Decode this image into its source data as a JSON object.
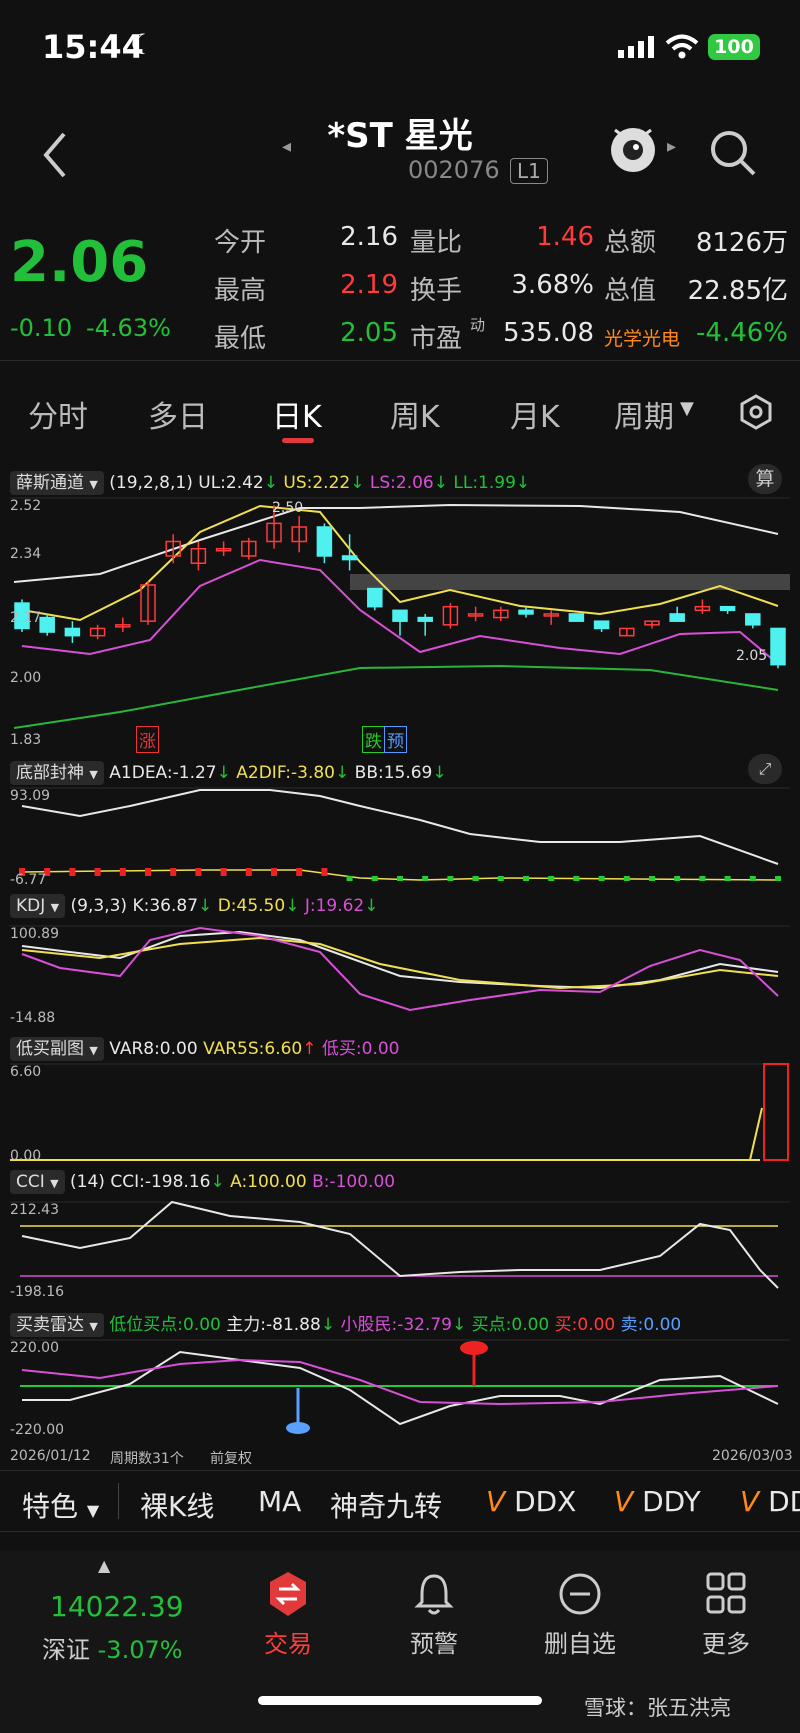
{
  "status": {
    "time": "15:44",
    "battery": "100"
  },
  "header": {
    "name": "*ST 星光",
    "code": "002076",
    "level": "L1"
  },
  "quote": {
    "price": "2.06",
    "change": "-0.10",
    "change_pct": "-4.63%",
    "rows": [
      {
        "l1": "今开",
        "v1": "2.16",
        "l2": "量比",
        "v2": "1.46",
        "l3": "总额",
        "v3": "8126万"
      },
      {
        "l1": "最高",
        "v1": "2.19",
        "l2": "换手",
        "v2": "3.68%",
        "l3": "总值",
        "v3": "22.85亿"
      },
      {
        "l1": "最低",
        "v1": "2.05",
        "l2": "市盈",
        "l2sup": "动",
        "v2": "535.08",
        "l3": "光学光电",
        "v3": "-4.46%"
      }
    ]
  },
  "tabs": [
    "分时",
    "多日",
    "日K",
    "周K",
    "月K",
    "周期"
  ],
  "panels": {
    "xs": {
      "name": "薛斯通道",
      "params": "(19,2,8,1)",
      "ul": "UL:2.42",
      "us": "US:2.22",
      "ls": "LS:2.06",
      "ll": "LL:1.99",
      "ticks": [
        "2.52",
        "2.34",
        "2.17",
        "2.00",
        "1.83"
      ],
      "hi": "2.50",
      "lo": "2.05",
      "tag1": "涨",
      "tag2": "跌",
      "tag3": "预",
      "icon": "算"
    },
    "dbfs": {
      "name": "底部封神",
      "a1": "A1DEA:-1.27",
      "a2": "A2DIF:-3.80",
      "bb": "BB:15.69",
      "ticks": [
        "93.09",
        "-6.77"
      ]
    },
    "kdj": {
      "name": "KDJ",
      "params": "(9,3,3)",
      "k": "K:36.87",
      "d": "D:45.50",
      "j": "J:19.62",
      "ticks": [
        "100.89",
        "-14.88"
      ]
    },
    "dm": {
      "name": "低买副图",
      "var8": "VAR8:0.00",
      "var5s": "VAR5S:6.60",
      "dm": "低买:0.00",
      "ticks": [
        "6.60",
        "0.00"
      ]
    },
    "cci": {
      "name": "CCI",
      "params": "(14)",
      "cci": "CCI:-198.16",
      "a": "A:100.00",
      "b": "B:-100.00",
      "ticks": [
        "212.43",
        "-198.16"
      ]
    },
    "mmld": {
      "name": "买卖雷达",
      "dwmd": "低位买点:0.00",
      "zl": "主力:-81.88",
      "xgm": "小股民:-32.79",
      "md": "买点:0.00",
      "buy": "买:0.00",
      "sell": "卖:0.00",
      "ticks": [
        "220.00",
        "-220.00"
      ]
    }
  },
  "footer_info": {
    "start": "2026/01/12",
    "count": "周期数31个",
    "adj": "前复权",
    "end": "2026/03/03"
  },
  "bottombar": [
    "特色",
    "裸K线",
    "MA",
    "神奇九转",
    "DDX",
    "DDY",
    "DD"
  ],
  "nav": {
    "index_value": "14022.39",
    "index_name": "深证",
    "index_pct": "-3.07%",
    "items": [
      "交易",
      "预警",
      "删自选",
      "更多"
    ]
  },
  "watermark": "雪球：张五洪亮",
  "chart_data": {
    "type": "candlestick",
    "x_start": "2026/01/12",
    "x_end": "2026/03/03",
    "ylim": [
      1.83,
      2.52
    ],
    "candles": [
      {
        "o": 2.23,
        "c": 2.16,
        "h": 2.24,
        "l": 2.15
      },
      {
        "o": 2.19,
        "c": 2.15,
        "h": 2.2,
        "l": 2.14
      },
      {
        "o": 2.16,
        "c": 2.14,
        "h": 2.18,
        "l": 2.12
      },
      {
        "o": 2.14,
        "c": 2.16,
        "h": 2.17,
        "l": 2.13
      },
      {
        "o": 2.17,
        "c": 2.17,
        "h": 2.19,
        "l": 2.15
      },
      {
        "o": 2.18,
        "c": 2.28,
        "h": 2.29,
        "l": 2.17
      },
      {
        "o": 2.36,
        "c": 2.4,
        "h": 2.42,
        "l": 2.34
      },
      {
        "o": 2.34,
        "c": 2.38,
        "h": 2.4,
        "l": 2.32
      },
      {
        "o": 2.38,
        "c": 2.38,
        "h": 2.4,
        "l": 2.36
      },
      {
        "o": 2.36,
        "c": 2.4,
        "h": 2.41,
        "l": 2.35
      },
      {
        "o": 2.4,
        "c": 2.45,
        "h": 2.5,
        "l": 2.38
      },
      {
        "o": 2.4,
        "c": 2.44,
        "h": 2.47,
        "l": 2.37
      },
      {
        "o": 2.44,
        "c": 2.36,
        "h": 2.45,
        "l": 2.34
      },
      {
        "o": 2.36,
        "c": 2.35,
        "h": 2.42,
        "l": 2.32
      },
      {
        "o": 2.27,
        "c": 2.22,
        "h": 2.27,
        "l": 2.21
      },
      {
        "o": 2.21,
        "c": 2.18,
        "h": 2.21,
        "l": 2.14
      },
      {
        "o": 2.19,
        "c": 2.18,
        "h": 2.2,
        "l": 2.14
      },
      {
        "o": 2.17,
        "c": 2.22,
        "h": 2.23,
        "l": 2.16
      },
      {
        "o": 2.2,
        "c": 2.2,
        "h": 2.22,
        "l": 2.18
      },
      {
        "o": 2.19,
        "c": 2.21,
        "h": 2.22,
        "l": 2.18
      },
      {
        "o": 2.21,
        "c": 2.2,
        "h": 2.22,
        "l": 2.19
      },
      {
        "o": 2.2,
        "c": 2.2,
        "h": 2.21,
        "l": 2.17
      },
      {
        "o": 2.2,
        "c": 2.18,
        "h": 2.2,
        "l": 2.18
      },
      {
        "o": 2.18,
        "c": 2.16,
        "h": 2.18,
        "l": 2.15
      },
      {
        "o": 2.14,
        "c": 2.16,
        "h": 2.16,
        "l": 2.14
      },
      {
        "o": 2.17,
        "c": 2.18,
        "h": 2.18,
        "l": 2.16
      },
      {
        "o": 2.2,
        "c": 2.18,
        "h": 2.22,
        "l": 2.18
      },
      {
        "o": 2.21,
        "c": 2.22,
        "h": 2.24,
        "l": 2.2
      },
      {
        "o": 2.22,
        "c": 2.21,
        "h": 2.22,
        "l": 2.2
      },
      {
        "o": 2.2,
        "c": 2.17,
        "h": 2.2,
        "l": 2.16
      },
      {
        "o": 2.16,
        "c": 2.06,
        "h": 2.16,
        "l": 2.05
      }
    ]
  }
}
